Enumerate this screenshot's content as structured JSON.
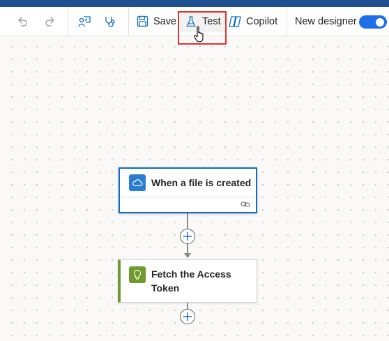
{
  "toolbar": {
    "undo_icon": "undo-icon",
    "redo_icon": "redo-icon",
    "present_icon": "presenter-icon",
    "checker_icon": "stethoscope-icon",
    "save_label": "Save",
    "test_label": "Test",
    "copilot_label": "Copilot",
    "new_designer_label": "New designer",
    "new_designer_enabled": true
  },
  "flow": {
    "trigger": {
      "title": "When a file is created",
      "icon": "onedrive-cloud-icon",
      "icon_color": "#2b7cd3"
    },
    "action": {
      "title": "Fetch the Access Token",
      "icon": "lightbulb-icon",
      "icon_color": "#6e9b2f"
    }
  },
  "colors": {
    "accent": "#0f6cbd",
    "highlight": "#e03131",
    "header": "#1d4f91"
  }
}
